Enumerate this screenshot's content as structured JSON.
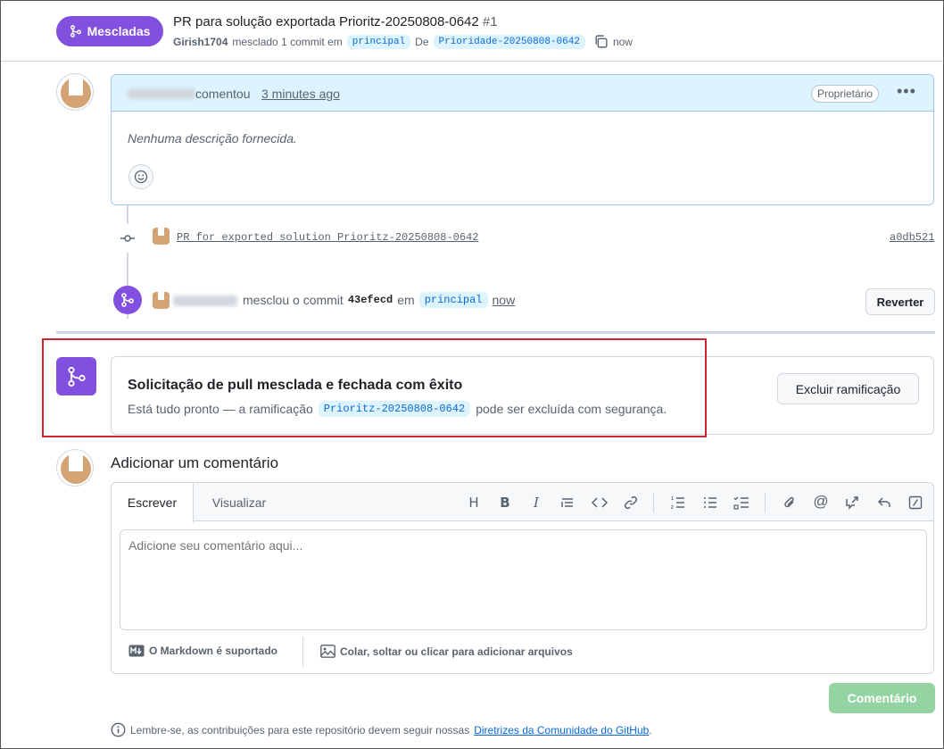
{
  "header": {
    "state_label": "Mescladas",
    "title": "PR para solução exportada Prioritz-20250808-0642",
    "number": "#1",
    "author": "Girish1704",
    "merged_text": "mesclado 1 commit em",
    "base_branch": "principal",
    "from_text": "De",
    "head_branch": "Prioridade-20250808-0642",
    "time": "now"
  },
  "comment": {
    "action": "comentou",
    "time": "3 minutes ago",
    "role_badge": "Proprietário",
    "body": "Nenhuma descrição fornecida."
  },
  "timeline": {
    "commit_message": "PR for exported solution Prioritz-20250808-0642",
    "commit_sha": "a0db521",
    "merge_text": "mesclou o commit",
    "merge_sha": "43efecd",
    "merge_in": "em",
    "merge_branch": "principal",
    "merge_time": "now",
    "revert_label": "Reverter"
  },
  "merged_box": {
    "title": "Solicitação de pull mesclada e fechada com êxito",
    "desc_before": "Está tudo pronto — a ramificação",
    "branch": "Prioritz-20250808-0642",
    "desc_after": "pode ser excluída com segurança.",
    "delete_label": "Excluir ramificação"
  },
  "add_comment": {
    "heading": "Adicionar um comentário",
    "tab_write": "Escrever",
    "tab_preview": "Visualizar",
    "placeholder": "Adicione seu comentário aqui...",
    "markdown_note": "O Markdown é suportado",
    "attach_note": "Colar, soltar ou clicar para adicionar arquivos",
    "submit_label": "Comentário"
  },
  "footer": {
    "text": "Lembre-se, as contribuições para este repositório devem seguir nossas",
    "link": "Diretrizes da Comunidade do GitHub",
    "period": "."
  },
  "colors": {
    "merged_purple": "#8250df",
    "highlight_red": "#d1242f",
    "submit_green": "#94d3a2",
    "link_blue": "#0969da"
  }
}
